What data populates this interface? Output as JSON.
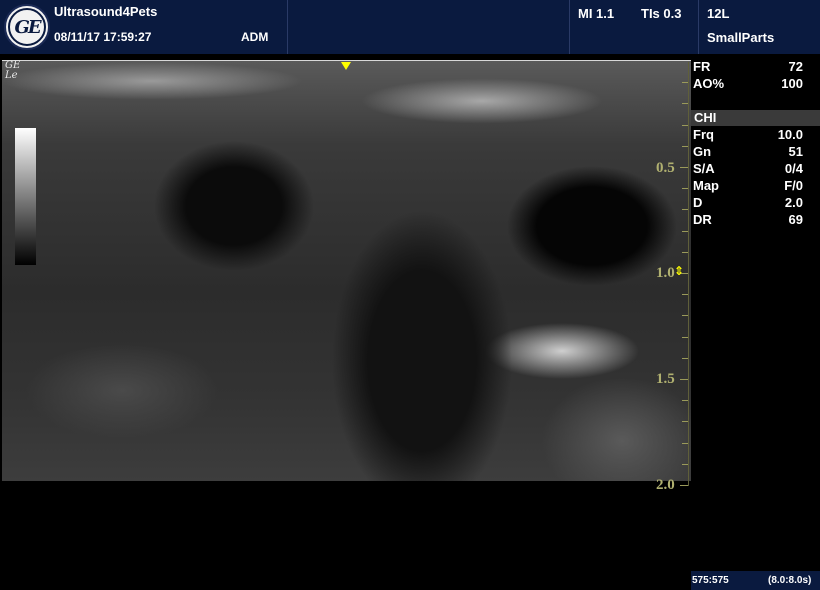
{
  "header": {
    "clinic": "Ultrasound4Pets",
    "datetime": "08/11/17 17:59:27",
    "operator": "ADM",
    "mi": "MI 1.1",
    "tis": "TIs 0.3",
    "probe": "12L",
    "preset": "SmallParts",
    "logo_text": "GE"
  },
  "image": {
    "corner_label_1": "GE",
    "corner_label_2": "Le"
  },
  "params_top": [
    {
      "key": "FR",
      "value": "72"
    },
    {
      "key": "AO%",
      "value": "100"
    }
  ],
  "mode": "CHI",
  "params": [
    {
      "key": "Frq",
      "value": "10.0"
    },
    {
      "key": "Gn",
      "value": "51"
    },
    {
      "key": "S/A",
      "value": "0/4"
    },
    {
      "key": "Map",
      "value": "F/0"
    },
    {
      "key": "D",
      "value": "2.0"
    },
    {
      "key": "DR",
      "value": "69"
    }
  ],
  "depth_scale": {
    "labels": [
      "0.5",
      "1.0",
      "1.5",
      "2.0"
    ],
    "max_cm": 2.0
  },
  "status": {
    "frame": "575:575",
    "cine": "(8.0:8.0s)"
  },
  "colors": {
    "header_bg": "#0a1a3f",
    "scale": "#b0b070",
    "marker": "#ffff00"
  }
}
